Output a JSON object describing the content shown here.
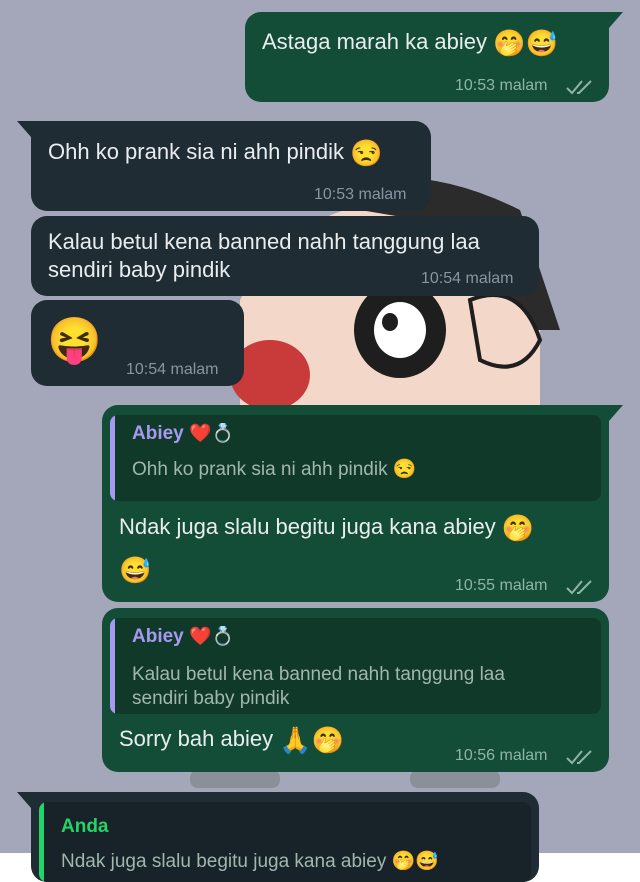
{
  "messages": [
    {
      "text": "Astaga marah ka abiey",
      "emoji": "🤭😅",
      "time": "10:53 malam"
    },
    {
      "text": "Ohh ko prank sia ni ahh pindik",
      "emoji": "😒",
      "time": "10:53 malam"
    },
    {
      "text_line1": "Kalau betul kena banned nahh tanggung laa",
      "text_line2": "sendiri baby pindik",
      "time": "10:54 malam"
    },
    {
      "emoji": "😝",
      "time": "10:54 malam"
    },
    {
      "quote_author": "Abiey",
      "quote_author_emoji": "❤️💍",
      "quote_text": "Ohh ko prank sia ni ahh pindik",
      "quote_emoji": "😒",
      "text": "Ndak juga slalu begitu juga kana abiey",
      "emoji": "🤭",
      "emoji2": "😅",
      "time": "10:55 malam"
    },
    {
      "quote_author": "Abiey",
      "quote_author_emoji": "❤️💍",
      "quote_line1": "Kalau betul kena banned nahh tanggung laa",
      "quote_line2": "sendiri baby pindik",
      "text": "Sorry bah abiey",
      "emoji": "🙏🤭",
      "time": "10:56 malam"
    },
    {
      "quote_author": "Anda",
      "quote_text": "Ndak juga slalu begitu juga kana abiey",
      "quote_emoji": "🤭😅"
    }
  ]
}
